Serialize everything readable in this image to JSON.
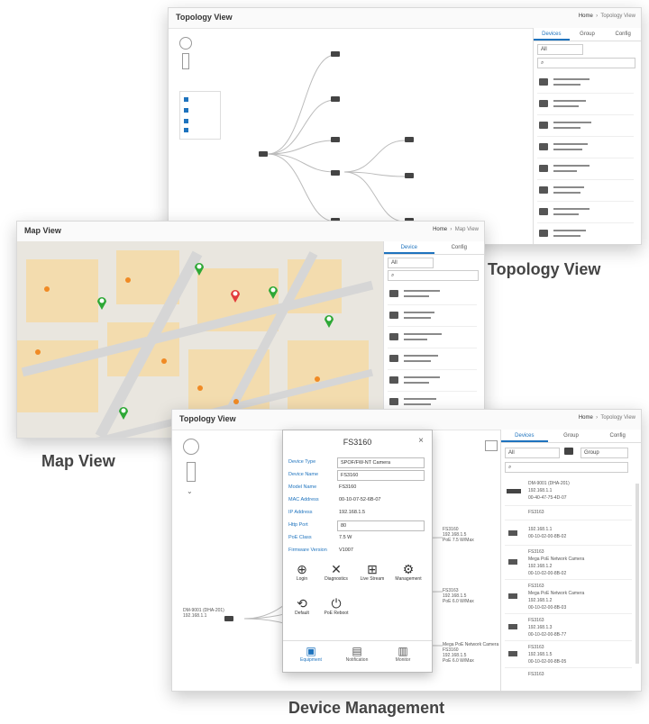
{
  "captions": {
    "topology": "Topology View",
    "map": "Map View",
    "device": "Device Management"
  },
  "screens": {
    "topology": {
      "title": "Topology View",
      "breadcrumb_home": "Home",
      "breadcrumb_path": "Topology View",
      "tabs": [
        "Devices",
        "Group",
        "Config"
      ],
      "filter": "All"
    },
    "map": {
      "title": "Map View",
      "breadcrumb_home": "Home",
      "breadcrumb_path": "Map View",
      "tabs": [
        "Device",
        "Config"
      ],
      "filter": "All"
    },
    "device": {
      "title": "Topology View",
      "breadcrumb_home": "Home",
      "breadcrumb_path": "Topology View",
      "tabs": [
        "Devices",
        "Group",
        "Config"
      ],
      "filter_left": "All",
      "filter_right": "Group",
      "list": [
        {
          "lines": [
            "DM-9001 (DHA-201)",
            "192.168.1.1",
            "00-40-47-75-4D-07"
          ]
        },
        {
          "lines": [
            "FS3163"
          ]
        },
        {
          "lines": [
            "192.168.1.1",
            "00-10-02-00-8B-02"
          ]
        },
        {
          "lines": [
            "FS3163",
            "Mega PoE Network Camera",
            "192.168.1.2",
            "00-10-02-00-8B-02"
          ]
        },
        {
          "lines": [
            "FS3163",
            "Mega PoE Network Camera",
            "192.168.1.2",
            "00-10-02-00-8B-03"
          ]
        },
        {
          "lines": [
            "FS3163",
            "192.168.1.3",
            "00-10-02-00-8B-77"
          ]
        },
        {
          "lines": [
            "FS3163",
            "192.168.1.5",
            "00-10-02-00-8B-05"
          ]
        },
        {
          "lines": [
            "FS3163"
          ]
        }
      ],
      "dialog": {
        "title": "FS3160",
        "fields": [
          {
            "label": "Device Type",
            "value": "SPOF/FW-NT Camera"
          },
          {
            "label": "Device Name",
            "value": "FS3160"
          },
          {
            "label": "Model Name",
            "value": "FS3160"
          },
          {
            "label": "MAC Address",
            "value": "00-10-07-52-6B-07"
          },
          {
            "label": "IP Address",
            "value": "192.168.1.5"
          },
          {
            "label": "Http Port",
            "value": "80"
          },
          {
            "label": "PoE Class",
            "value": "7.5 W"
          },
          {
            "label": "Firmware Version",
            "value": "V1007"
          }
        ],
        "actions": [
          "Login",
          "Diagnostics",
          "Live Stream",
          "Management",
          "Default",
          "PoE Reboot"
        ],
        "tabs": [
          "Equipment",
          "Notification",
          "Monitor"
        ]
      },
      "nodes": [
        {
          "text": "DM-9001 (DHA-201)\n192.168.1.1"
        },
        {
          "text": "FS3160\n192.168.1.5\nPoE 7.5 W/Max"
        },
        {
          "text": "Mega PoE Network Camera\nFS3160\n192.168.1.5\nPoE 6.0 W/Max"
        },
        {
          "text": "FS3163\n192.168.1.5\nPoE 6.0 W/Max"
        }
      ]
    }
  },
  "colors": {
    "accent": "#1e73be",
    "map_block": "#f3dcae",
    "pin_green": "#2ea836",
    "pin_red": "#e23b3b",
    "poi": "#f08a24"
  }
}
